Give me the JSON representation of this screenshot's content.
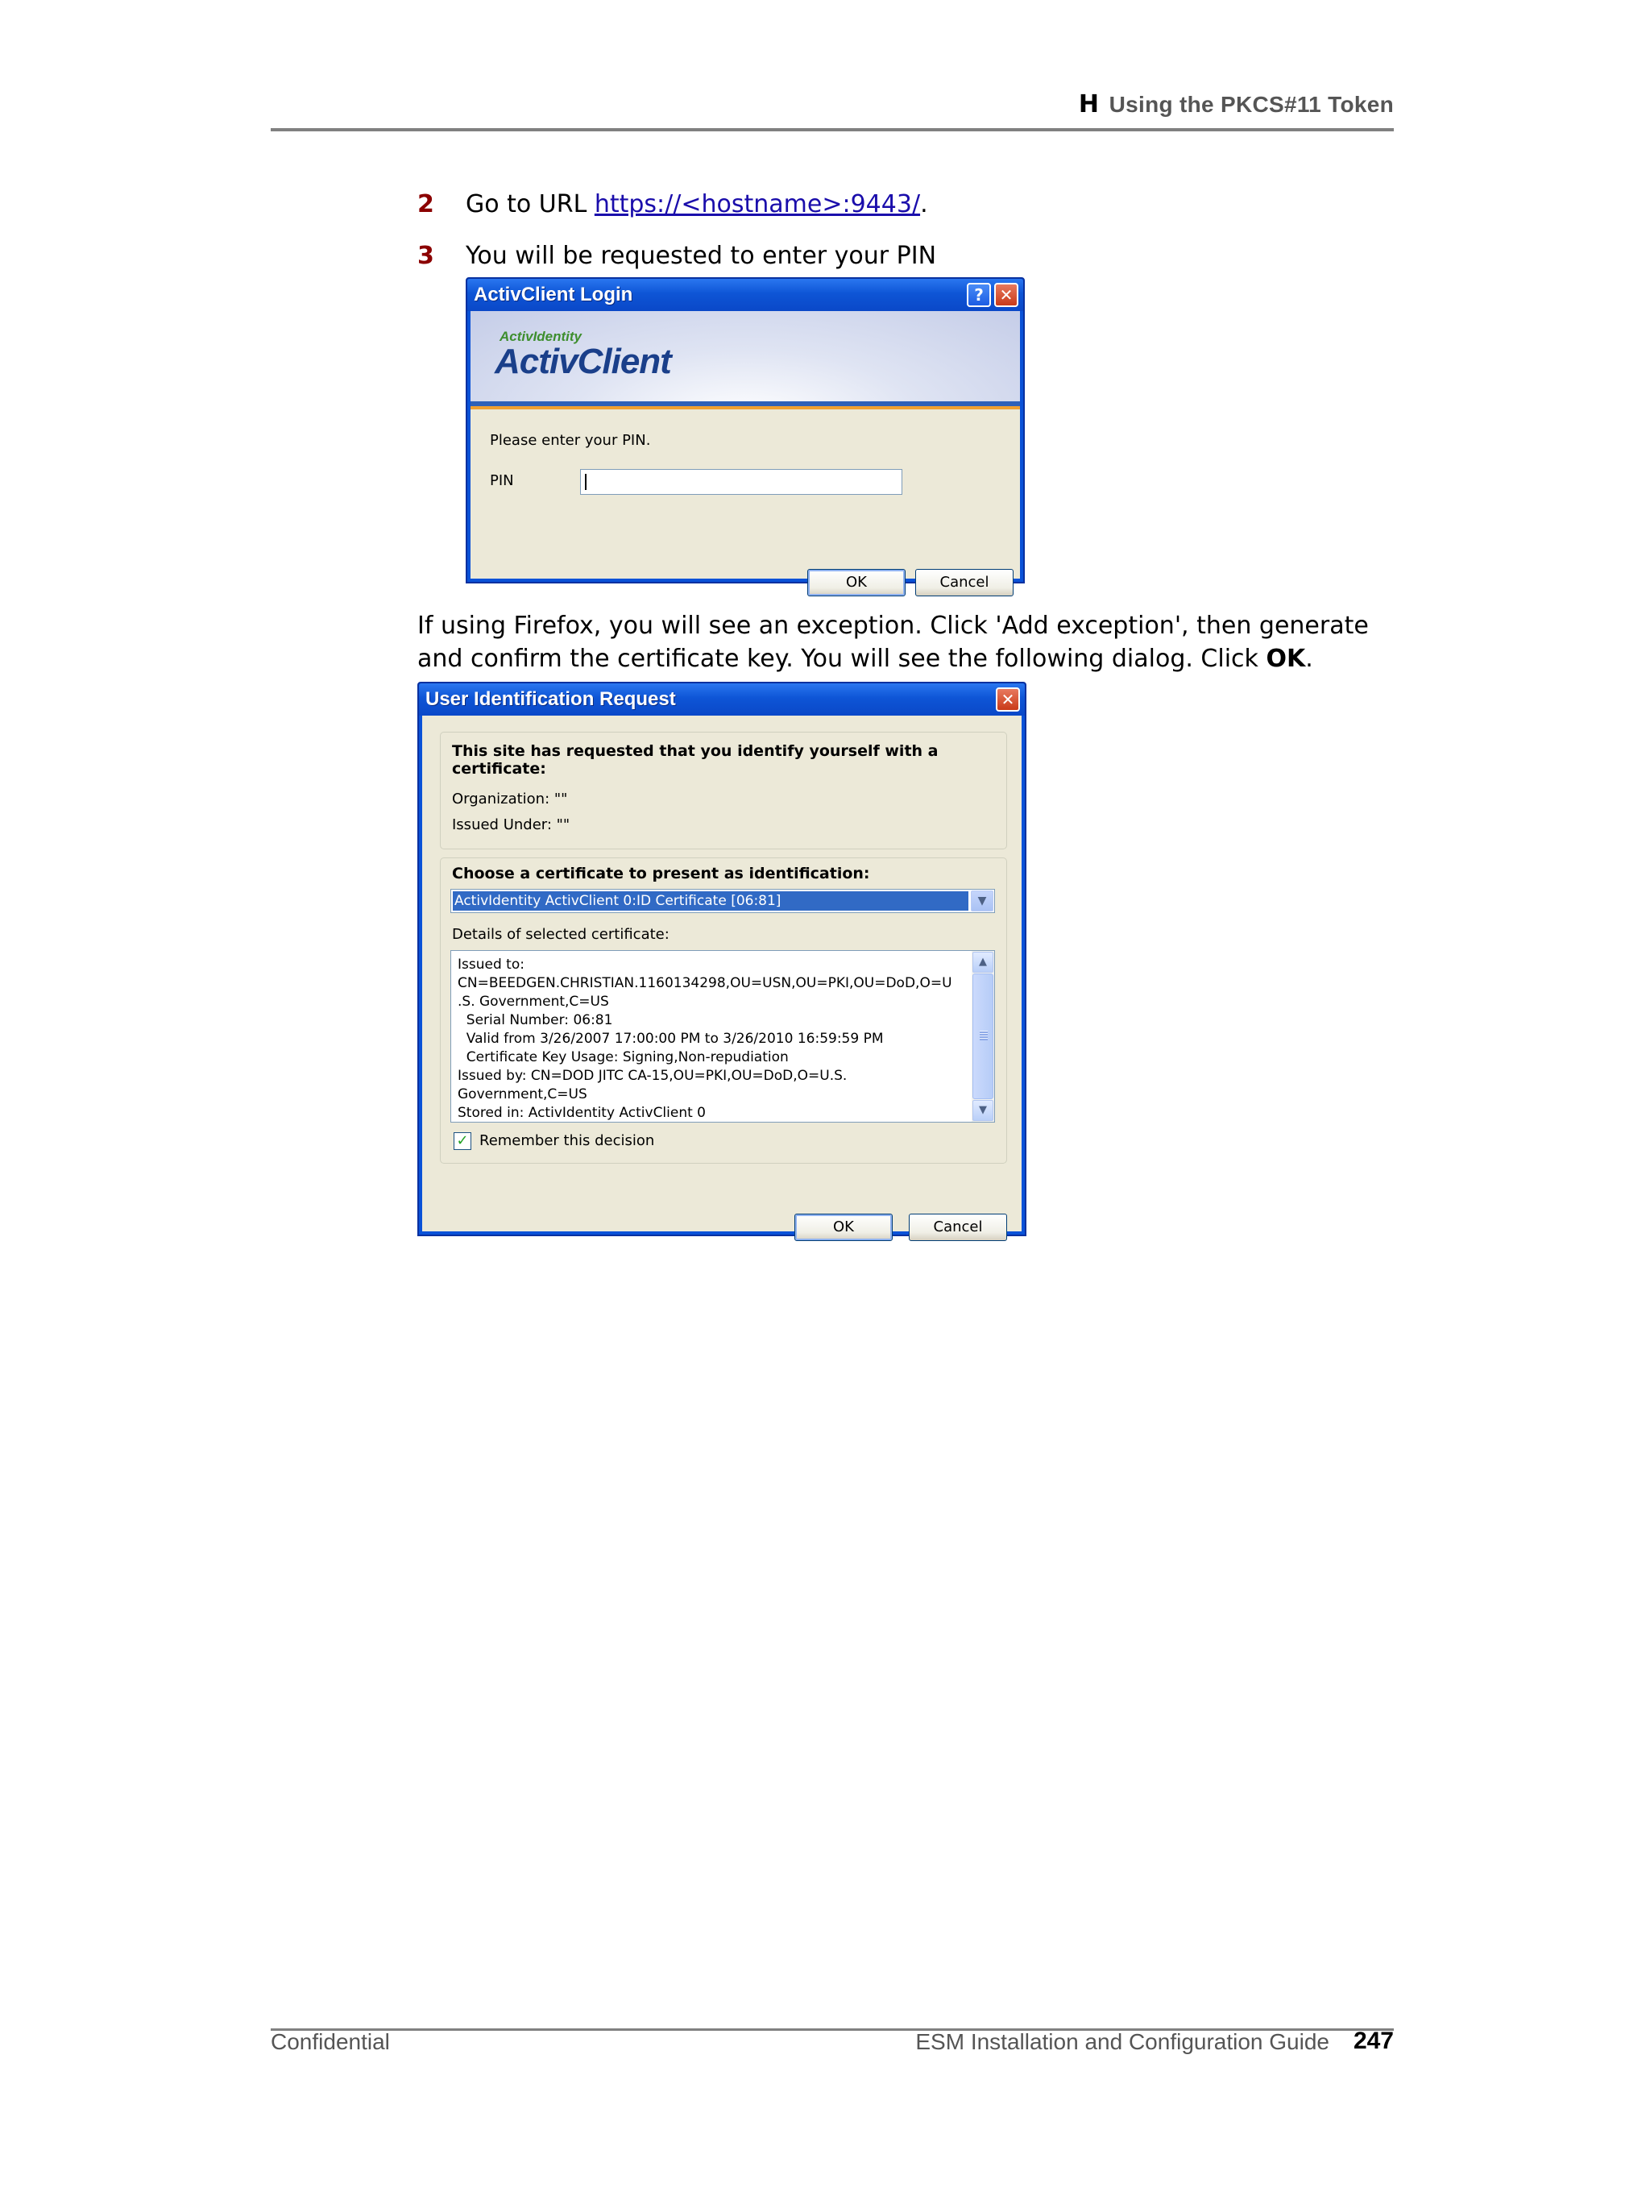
{
  "header": {
    "appendix_letter": "H",
    "chapter_title": "Using the PKCS#11 Token"
  },
  "steps": [
    {
      "number": "2",
      "text_before_link": "Go to URL ",
      "link": "https://<hostname>:9443/",
      "text_after_link": "."
    },
    {
      "number": "3",
      "text": "You will be requested to enter your PIN"
    }
  ],
  "paragraph": {
    "text_before_bold": "If using Firefox, you will see an exception. Click 'Add exception', then generate and confirm the certificate key. You will see the following dialog. Click ",
    "bold": "OK",
    "text_after_bold": "."
  },
  "activclient_dialog": {
    "title": "ActivClient Login",
    "help_glyph": "?",
    "close_glyph": "✕",
    "brand_small": "ActivIdentity",
    "brand_big": "ActivClient",
    "prompt": "Please enter your PIN.",
    "pin_label": "PIN",
    "pin_value": "",
    "ok_label": "OK",
    "cancel_label": "Cancel"
  },
  "user_id_dialog": {
    "title": "User Identification Request",
    "close_glyph": "✕",
    "site_requested": "This site has requested that you identify yourself with a certificate:",
    "organization": "Organization: \"\"",
    "issued_under": "Issued Under: \"\"",
    "choose_label": "Choose a certificate to present as identification:",
    "selected_certificate": "ActivIdentity ActivClient 0:ID Certificate [06:81]",
    "details_label": "Details of selected certificate:",
    "details": "Issued to:\nCN=BEEDGEN.CHRISTIAN.1160134298,OU=USN,OU=PKI,OU=DoD,O=U\n.S. Government,C=US\n  Serial Number: 06:81\n  Valid from 3/26/2007 17:00:00 PM to 3/26/2010 16:59:59 PM\n  Certificate Key Usage: Signing,Non-repudiation\nIssued by: CN=DOD JITC CA-15,OU=PKI,OU=DoD,O=U.S.\nGovernment,C=US\nStored in: ActivIdentity ActivClient 0",
    "remember_checked": true,
    "check_glyph": "✓",
    "remember_label": "Remember this decision",
    "ok_label": "OK",
    "cancel_label": "Cancel",
    "dropdown_glyph": "▼",
    "scroll_up_glyph": "▲",
    "scroll_down_glyph": "▼"
  },
  "footer": {
    "left": "Confidential",
    "guide_title": "ESM Installation and Configuration Guide",
    "page_number": "247"
  }
}
